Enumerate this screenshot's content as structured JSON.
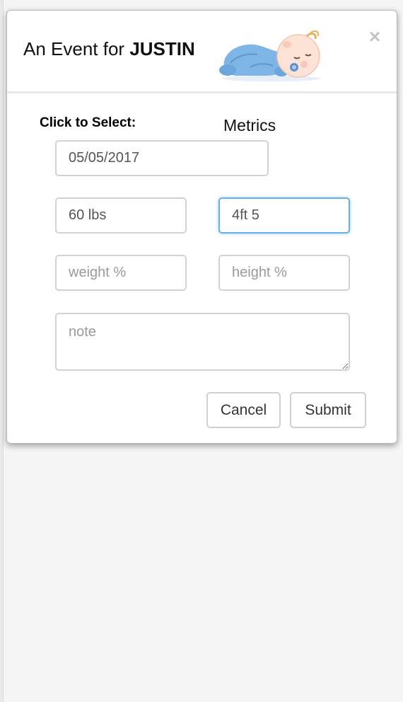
{
  "modal": {
    "title_prefix": "An Event for ",
    "title_name": "JUSTIN",
    "close_symbol": "×"
  },
  "form": {
    "select_label": "Click to Select:",
    "metrics_label": "Metrics",
    "date_value": "05/05/2017",
    "weight_value": "60 lbs",
    "height_value": "4ft 5",
    "weight_pct_placeholder": "weight %",
    "height_pct_placeholder": "height %",
    "note_placeholder": "note"
  },
  "buttons": {
    "cancel": "Cancel",
    "submit": "Submit"
  },
  "icons": {
    "close": "close-icon",
    "baby": "sleeping-baby-illustration"
  },
  "colors": {
    "focus_border": "#66afe9",
    "baby_body": "#7fb5e6",
    "page_bg": "#f5f5f5"
  }
}
